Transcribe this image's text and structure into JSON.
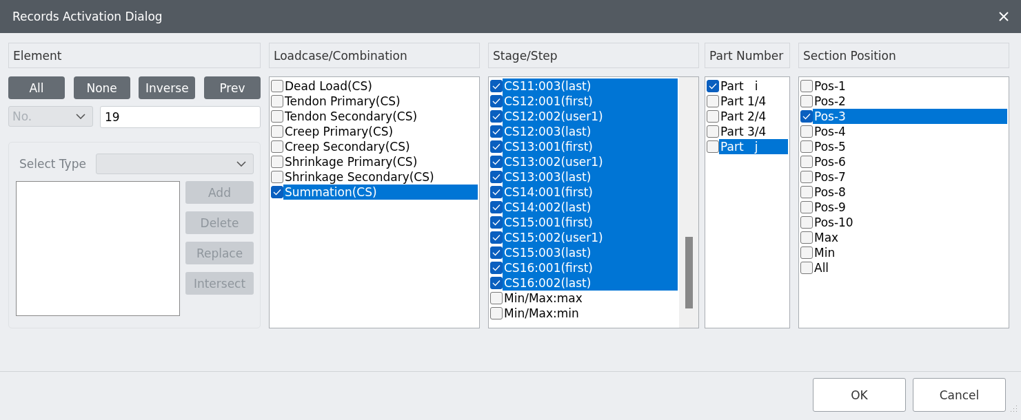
{
  "window": {
    "title": "Records Activation Dialog"
  },
  "element": {
    "header": "Element",
    "buttons": [
      "All",
      "None",
      "Inverse",
      "Prev"
    ],
    "id_type": {
      "value": "No.",
      "disabled": true
    },
    "id_value": "19",
    "select_type": {
      "label": "Select Type",
      "disabled": true
    },
    "side_buttons": [
      {
        "label": "Add",
        "disabled": true
      },
      {
        "label": "Delete",
        "disabled": true
      },
      {
        "label": "Replace",
        "disabled": true
      },
      {
        "label": "Intersect",
        "disabled": true
      }
    ]
  },
  "lists": [
    {
      "header": "Loadcase/Combination",
      "scrollbar": false,
      "items": [
        {
          "label": "Dead Load(CS)",
          "checked": false,
          "selected": false
        },
        {
          "label": "Tendon Primary(CS)",
          "checked": false,
          "selected": false
        },
        {
          "label": "Tendon Secondary(CS)",
          "checked": false,
          "selected": false
        },
        {
          "label": "Creep Primary(CS)",
          "checked": false,
          "selected": false
        },
        {
          "label": "Creep Secondary(CS)",
          "checked": false,
          "selected": false
        },
        {
          "label": "Shrinkage Primary(CS)",
          "checked": false,
          "selected": false
        },
        {
          "label": "Shrinkage Secondary(CS)",
          "checked": false,
          "selected": false
        },
        {
          "label": "Summation(CS)",
          "checked": true,
          "selected": true
        }
      ]
    },
    {
      "header": "Stage/Step",
      "scrollbar": true,
      "items": [
        {
          "label": "CS11:003(last)",
          "checked": true,
          "selected": true
        },
        {
          "label": "CS12:001(first)",
          "checked": true,
          "selected": true
        },
        {
          "label": "CS12:002(user1)",
          "checked": true,
          "selected": true
        },
        {
          "label": "CS12:003(last)",
          "checked": true,
          "selected": true
        },
        {
          "label": "CS13:001(first)",
          "checked": true,
          "selected": true
        },
        {
          "label": "CS13:002(user1)",
          "checked": true,
          "selected": true
        },
        {
          "label": "CS13:003(last)",
          "checked": true,
          "selected": true
        },
        {
          "label": "CS14:001(first)",
          "checked": true,
          "selected": true
        },
        {
          "label": "CS14:002(last)",
          "checked": true,
          "selected": true
        },
        {
          "label": "CS15:001(first)",
          "checked": true,
          "selected": true
        },
        {
          "label": "CS15:002(user1)",
          "checked": true,
          "selected": true
        },
        {
          "label": "CS15:003(last)",
          "checked": true,
          "selected": true
        },
        {
          "label": "CS16:001(first)",
          "checked": true,
          "selected": true
        },
        {
          "label": "CS16:002(last)",
          "checked": true,
          "selected": true
        },
        {
          "label": "Min/Max:max",
          "checked": false,
          "selected": false
        },
        {
          "label": "Min/Max:min",
          "checked": false,
          "selected": false
        }
      ]
    },
    {
      "header": "Part Number",
      "scrollbar": false,
      "items": [
        {
          "label": "Part   i",
          "checked": true,
          "selected": false
        },
        {
          "label": "Part 1/4",
          "checked": false,
          "selected": false
        },
        {
          "label": "Part 2/4",
          "checked": false,
          "selected": false
        },
        {
          "label": "Part 3/4",
          "checked": false,
          "selected": false
        },
        {
          "label": "Part   j",
          "checked": false,
          "selected": true
        }
      ]
    },
    {
      "header": "Section Position",
      "scrollbar": false,
      "items": [
        {
          "label": "Pos-1",
          "checked": false,
          "selected": false
        },
        {
          "label": "Pos-2",
          "checked": false,
          "selected": false
        },
        {
          "label": "Pos-3",
          "checked": true,
          "selected": true
        },
        {
          "label": "Pos-4",
          "checked": false,
          "selected": false
        },
        {
          "label": "Pos-5",
          "checked": false,
          "selected": false
        },
        {
          "label": "Pos-6",
          "checked": false,
          "selected": false
        },
        {
          "label": "Pos-7",
          "checked": false,
          "selected": false
        },
        {
          "label": "Pos-8",
          "checked": false,
          "selected": false
        },
        {
          "label": "Pos-9",
          "checked": false,
          "selected": false
        },
        {
          "label": "Pos-10",
          "checked": false,
          "selected": false
        },
        {
          "label": "Max",
          "checked": false,
          "selected": false
        },
        {
          "label": "Min",
          "checked": false,
          "selected": false
        },
        {
          "label": "All",
          "checked": false,
          "selected": false
        }
      ]
    }
  ],
  "footer_buttons": [
    "OK",
    "Cancel"
  ]
}
